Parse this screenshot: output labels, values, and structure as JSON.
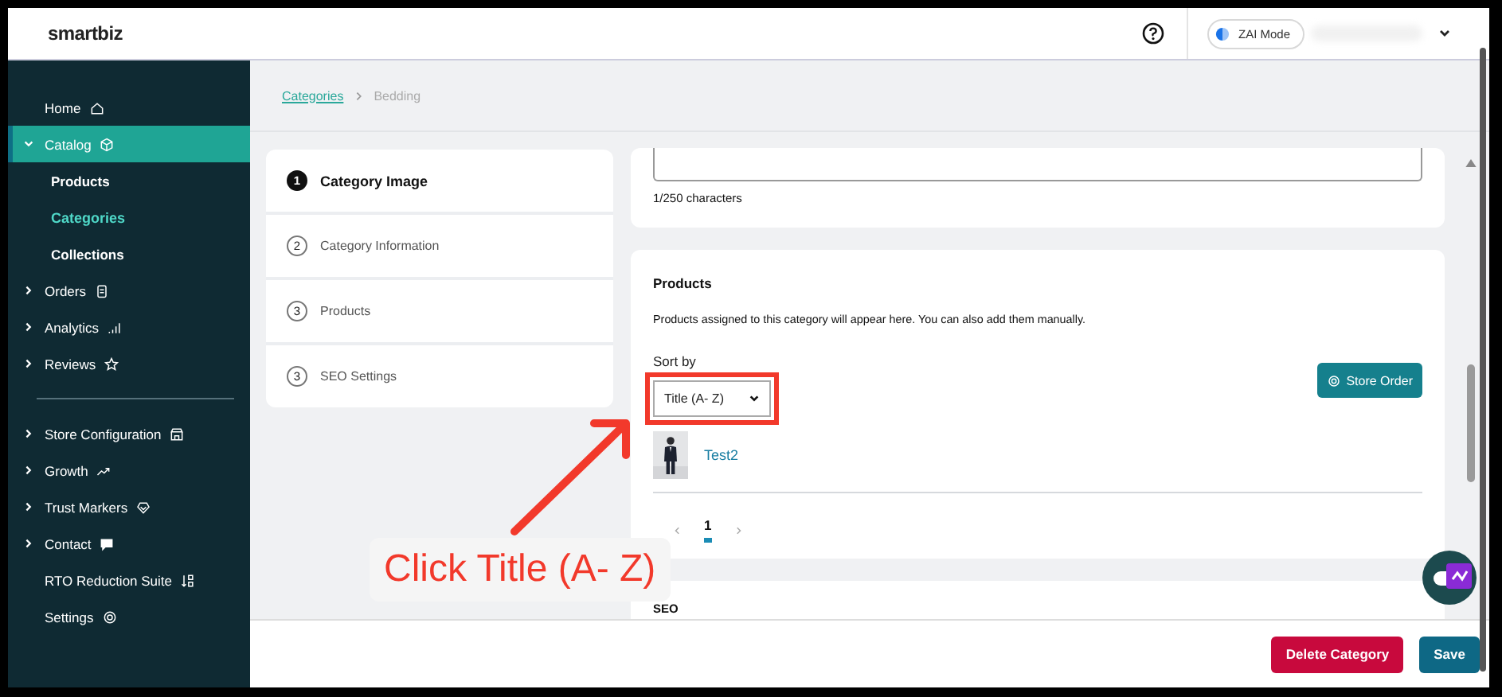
{
  "logo": {
    "text": "smartbiz"
  },
  "header": {
    "mode_label": "ZAI Mode"
  },
  "sidebar": {
    "groups": [
      [
        {
          "label": "Home",
          "kind": "link",
          "selected": false
        },
        {
          "label": "Catalog",
          "kind": "group",
          "expanded": true,
          "selected": true,
          "children": [
            {
              "label": "Products",
              "selected": false
            },
            {
              "label": "Categories",
              "selected": true
            },
            {
              "label": "Collections",
              "selected": false
            }
          ]
        },
        {
          "label": "Orders",
          "kind": "group",
          "expanded": false,
          "selected": false
        },
        {
          "label": "Analytics",
          "kind": "group",
          "expanded": false,
          "selected": false
        },
        {
          "label": "Reviews",
          "kind": "group",
          "expanded": false,
          "selected": false
        }
      ],
      [
        {
          "label": "Store Configuration",
          "kind": "group",
          "expanded": false,
          "selected": false
        },
        {
          "label": "Growth",
          "kind": "group",
          "expanded": false,
          "selected": false
        },
        {
          "label": "Trust Markers",
          "kind": "group",
          "expanded": false,
          "selected": false
        },
        {
          "label": "Contact",
          "kind": "group",
          "expanded": false,
          "selected": false
        },
        {
          "label": "RTO Reduction Suite",
          "kind": "link",
          "selected": false
        },
        {
          "label": "Settings",
          "kind": "link",
          "selected": false
        }
      ]
    ]
  },
  "breadcrumb": [
    {
      "label": "Categories",
      "kind": "link"
    },
    {
      "label": "Bedding",
      "kind": "current"
    }
  ],
  "steps": [
    {
      "number": "1",
      "label": "Category Image",
      "selected": true
    },
    {
      "number": "2",
      "label": "Category Information",
      "selected": false
    },
    {
      "number": "3",
      "label": "Products",
      "selected": false
    },
    {
      "number": "3",
      "label": "SEO Settings",
      "selected": false
    }
  ],
  "description_card": {
    "counter": "1/250 characters"
  },
  "products": {
    "title": "Products",
    "description": "Products assigned to this category will appear here. You can also add them manually.",
    "sort_label": "Sort by",
    "sort_value": "Title (A- Z)",
    "sort_highlighted": true,
    "store_order_button": "Store Order",
    "items": [
      {
        "name": "Test2"
      }
    ],
    "pagination": [
      {
        "label": "1",
        "selected": true
      }
    ]
  },
  "seo_card": {
    "title": "SEO"
  },
  "footer": {
    "buttons": [
      {
        "label": "Delete Category",
        "kind": "danger"
      },
      {
        "label": "Save",
        "kind": "primary"
      }
    ]
  },
  "annotation": {
    "label": "Click Title (A- Z)"
  }
}
